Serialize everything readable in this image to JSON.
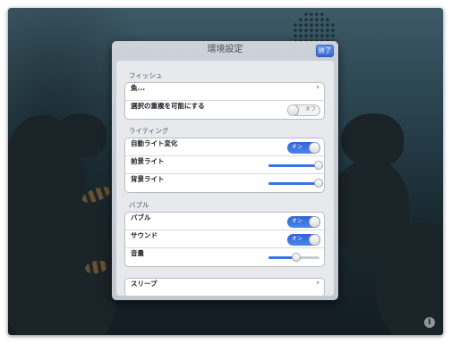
{
  "popover": {
    "title": "環境設定",
    "done_label": "終了"
  },
  "sections": {
    "fish": {
      "title": "フィッシュ",
      "rows": {
        "fish_select": "魚...",
        "allow_overlap": "選択の重複を可能にする"
      },
      "allow_overlap_switch": "オフ"
    },
    "lighting": {
      "title": "ライティング",
      "rows": {
        "auto_light": "自動ライト変化",
        "front_light": "前景ライト",
        "back_light": "背景ライト"
      },
      "auto_light_switch": "オン",
      "front_light_level": 0.98,
      "back_light_level": 0.98
    },
    "bubble": {
      "title": "バブル",
      "rows": {
        "bubble": "バブル",
        "sound": "サウンド",
        "volume": "音量"
      },
      "bubble_switch": "オン",
      "sound_switch": "オン",
      "volume_level": 0.55
    },
    "sleep": {
      "label": "スリープ"
    }
  },
  "icons": {
    "chevron": "›",
    "info": "i"
  },
  "colors": {
    "accent": "#3a74e3",
    "switch_on": "#2e64d3",
    "done_button": "#3466d8"
  }
}
